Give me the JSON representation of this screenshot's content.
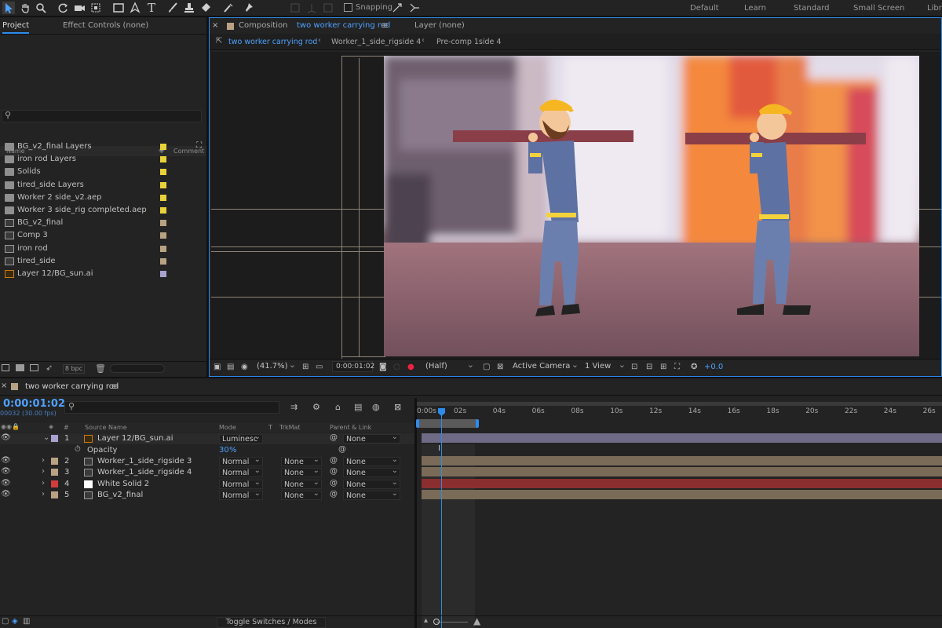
{
  "toolbar": {
    "snapping_label": "Snapping",
    "workspaces": [
      "Default",
      "Learn",
      "Standard",
      "Small Screen",
      "Libra"
    ]
  },
  "project_panel": {
    "tab_project": "Project",
    "tab_effect_controls": "Effect Controls (none)",
    "columns": {
      "name": "Name",
      "comment": "Comment"
    },
    "items": [
      {
        "name": "BG_v2_final Layers",
        "type": "folder",
        "color": "#e8d23a"
      },
      {
        "name": "iron rod Layers",
        "type": "folder",
        "color": "#e8d23a"
      },
      {
        "name": "Solids",
        "type": "folder",
        "color": "#e8d23a"
      },
      {
        "name": "tired_side Layers",
        "type": "folder",
        "color": "#e8d23a"
      },
      {
        "name": "Worker 2 side_v2.aep",
        "type": "folder",
        "color": "#e8d23a"
      },
      {
        "name": "Worker 3 side_rig completed.aep",
        "type": "folder",
        "color": "#e8d23a"
      },
      {
        "name": "BG_v2_final",
        "type": "comp",
        "color": "#b9a283"
      },
      {
        "name": "Comp 3",
        "type": "comp",
        "color": "#b9a283"
      },
      {
        "name": "iron rod",
        "type": "comp",
        "color": "#b9a283"
      },
      {
        "name": "tired_side",
        "type": "comp",
        "color": "#b9a283"
      },
      {
        "name": "Layer 12/BG_sun.ai",
        "type": "ai",
        "color": "#a9a2cf"
      }
    ],
    "bpc_label": "8 bpc"
  },
  "comp_panel": {
    "header_prefix": "Composition",
    "header_comp": "two worker carrying rod",
    "layer_tab": "Layer (none)",
    "breadcrumbs": [
      "two worker carrying rod",
      "Worker_1_side_rigside 4",
      "Pre-comp 1side 4"
    ],
    "zoom": "(41.7%)",
    "timecode": "0:00:01:02",
    "resolution": "(Half)",
    "camera": "Active Camera",
    "view": "1 View",
    "exposure": "+0.0"
  },
  "timeline": {
    "tab_label": "two worker carrying rod",
    "timecode": "0:00:01:02",
    "frame_info": "00032 (30.00 fps)",
    "columns": {
      "source": "Source Name",
      "mode": "Mode",
      "t": "T",
      "trkmat": "TrkMat",
      "parent": "Parent & Link"
    },
    "ruler": [
      "0:00s",
      "02s",
      "04s",
      "06s",
      "08s",
      "10s",
      "12s",
      "14s",
      "16s",
      "18s",
      "20s",
      "22s",
      "24s",
      "26s"
    ],
    "layers": [
      {
        "num": "1",
        "name": "Layer 12/BG_sun.ai",
        "mode": "Luminesc",
        "trkmat": "",
        "parent": "None",
        "color": "#a9a2cf",
        "bar": "#6f6a86",
        "icon": "ai"
      },
      {
        "num": "2",
        "name": "Worker_1_side_rigside 3",
        "mode": "Normal",
        "trkmat": "None",
        "parent": "None",
        "color": "#b9a283",
        "bar": "#7a6b58",
        "icon": "comp"
      },
      {
        "num": "3",
        "name": "Worker_1_side_rigside 4",
        "mode": "Normal",
        "trkmat": "None",
        "parent": "None",
        "color": "#b9a283",
        "bar": "#7a6b58",
        "icon": "comp"
      },
      {
        "num": "4",
        "name": "White Solid 2",
        "mode": "Normal",
        "trkmat": "None",
        "parent": "None",
        "color": "#d23c3c",
        "bar": "#8a2e30",
        "icon": "solid"
      },
      {
        "num": "5",
        "name": "BG_v2_final",
        "mode": "Normal",
        "trkmat": "None",
        "parent": "None",
        "color": "#b9a283",
        "bar": "#7a6b58",
        "icon": "comp"
      }
    ],
    "opacity_label": "Opacity",
    "opacity_value": "30",
    "opacity_unit": "%",
    "toggle_label": "Toggle Switches / Modes"
  }
}
